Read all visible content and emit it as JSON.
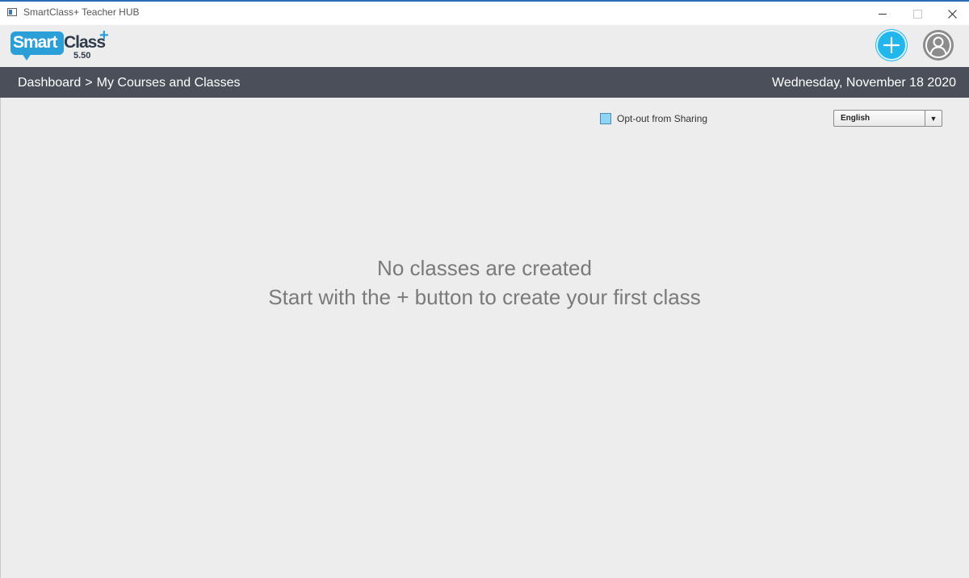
{
  "window": {
    "title": "SmartClass+ Teacher HUB"
  },
  "logo": {
    "smart": "Smart",
    "class": "Class",
    "plus": "+",
    "version": "5.50"
  },
  "header": {
    "add_icon": "plus-circle-icon",
    "profile_icon": "user-profile-icon",
    "accent": "#22b7ec"
  },
  "nav": {
    "breadcrumb": [
      "Dashboard",
      ">",
      "My Courses and Classes"
    ],
    "date": "Wednesday, November 18 2020",
    "bg": "#4a4f5a"
  },
  "options": {
    "optout_label": "Opt-out from Sharing",
    "language": "English"
  },
  "empty_state": {
    "line1": "No classes are created",
    "line2": "Start with the + button to create your first class"
  }
}
